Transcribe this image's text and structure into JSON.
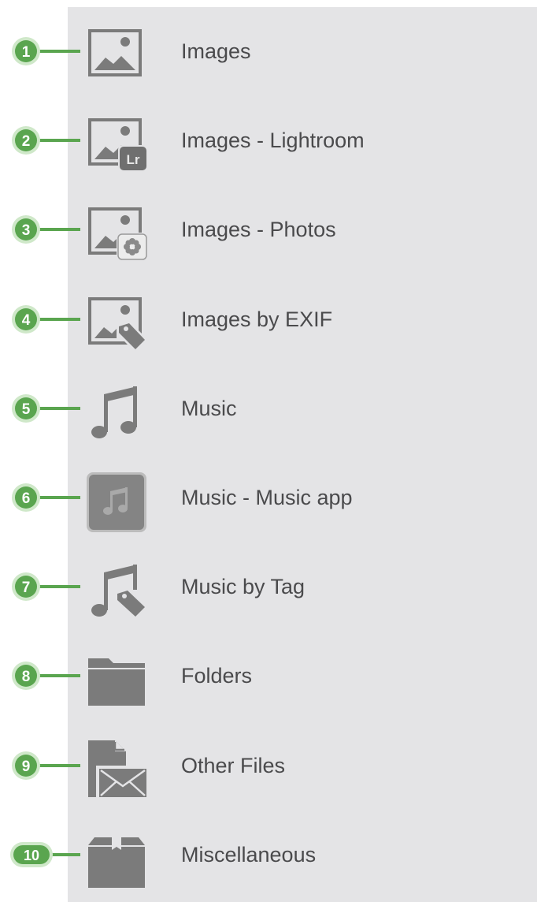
{
  "colors": {
    "panel_background": "#e4e4e6",
    "callout_green": "#5aa54f",
    "callout_ring": "#cfe8c9",
    "icon_gray": "#7b7b7b",
    "label_text": "#4a4a4c"
  },
  "items": [
    {
      "number": "1",
      "label": "Images",
      "icon": "image-icon"
    },
    {
      "number": "2",
      "label": "Images - Lightroom",
      "icon": "image-lightroom-icon",
      "badge": "Lr"
    },
    {
      "number": "3",
      "label": "Images - Photos",
      "icon": "image-photos-icon"
    },
    {
      "number": "4",
      "label": "Images by EXIF",
      "icon": "image-tag-icon"
    },
    {
      "number": "5",
      "label": "Music",
      "icon": "music-note-icon"
    },
    {
      "number": "6",
      "label": "Music - Music app",
      "icon": "music-app-icon"
    },
    {
      "number": "7",
      "label": "Music by Tag",
      "icon": "music-tag-icon"
    },
    {
      "number": "8",
      "label": "Folders",
      "icon": "folder-icon"
    },
    {
      "number": "9",
      "label": "Other Files",
      "icon": "document-mail-icon"
    },
    {
      "number": "10",
      "label": "Miscellaneous",
      "icon": "box-icon"
    }
  ]
}
